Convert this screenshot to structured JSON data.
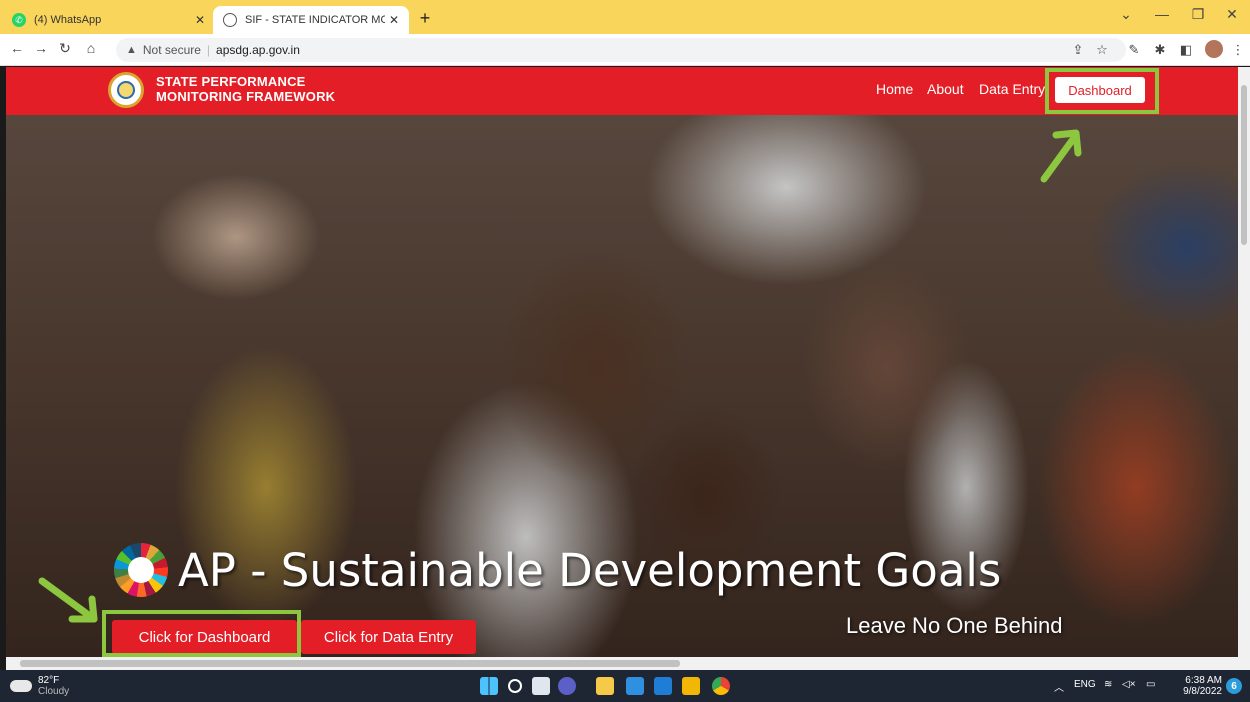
{
  "browser": {
    "tabs": [
      {
        "title": "(4) WhatsApp",
        "active": false
      },
      {
        "title": "SIF - STATE INDICATOR MONITO",
        "active": true
      }
    ],
    "new_tab": "+",
    "address": {
      "security": "Not secure",
      "url": "apsdg.ap.gov.in"
    }
  },
  "site": {
    "brand_line1": "STATE PERFORMANCE",
    "brand_line2": "MONITORING FRAMEWORK",
    "nav": [
      {
        "label": "Home"
      },
      {
        "label": "About"
      },
      {
        "label": "Data Entry"
      }
    ],
    "dashboard_button": "Dashboard"
  },
  "hero": {
    "title": "AP - Sustainable Development Goals",
    "tagline": "Leave No One Behind",
    "cta_dashboard": "Click for Dashboard",
    "cta_data_entry": "Click for Data Entry"
  },
  "annotation_color": "#8dc63f",
  "brand_red": "#e31e26",
  "taskbar": {
    "weather_temp": "82°F",
    "weather_cond": "Cloudy",
    "language": "ENG",
    "time": "6:38 AM",
    "date": "9/8/2022",
    "notifications": "6"
  }
}
